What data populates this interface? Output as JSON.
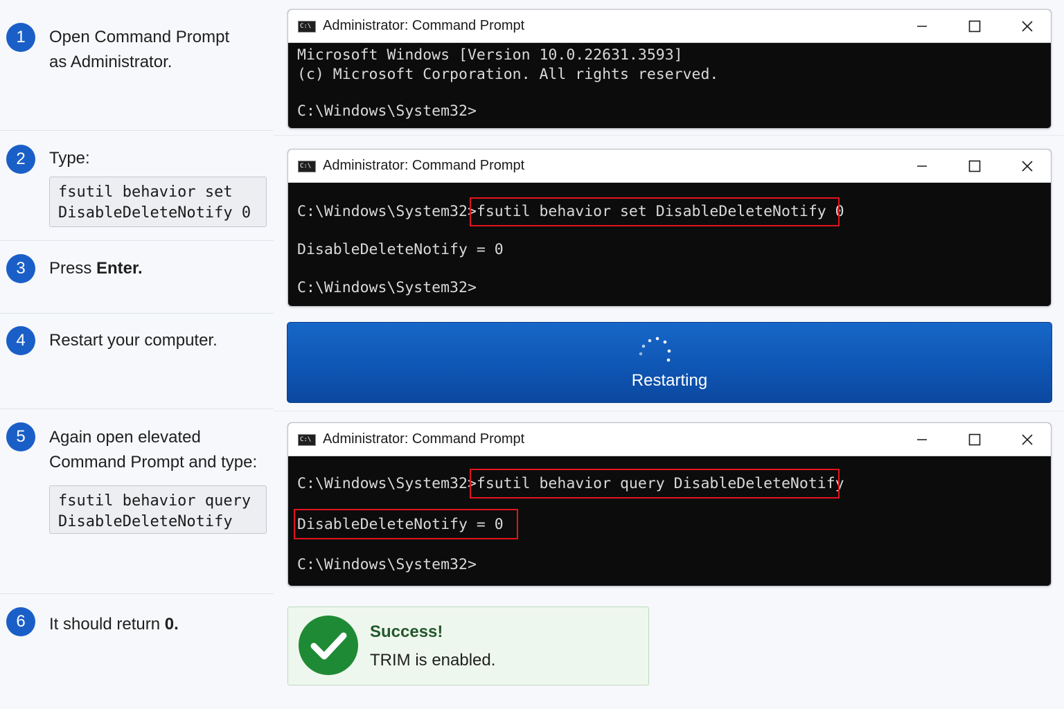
{
  "steps": [
    {
      "number": "1",
      "line1": "Open Command Prompt",
      "line2": "as Administrator."
    },
    {
      "number": "2",
      "line1": "Type:",
      "code": "fsutil behavior set\nDisableDeleteNotify 0"
    },
    {
      "number": "3",
      "prefix": "Press ",
      "bold": "Enter."
    },
    {
      "number": "4",
      "line1": "Restart your computer."
    },
    {
      "number": "5",
      "line1": "Again open elevated",
      "line2": "Command Prompt and type:",
      "code": "fsutil behavior query\nDisableDeleteNotify"
    },
    {
      "number": "6",
      "prefix": "It should return ",
      "bold": "0."
    }
  ],
  "icon_label": "C:\\",
  "window_title": "Administrator: Command Prompt",
  "windows": [
    {
      "lines": [
        "Microsoft Windows [Version 10.0.22631.3593]",
        "(c) Microsoft Corporation. All rights reserved.",
        "C:\\Windows\\System32>"
      ]
    },
    {
      "lines": [
        "C:\\Windows\\System32>fsutil behavior set DisableDeleteNotify 0",
        "DisableDeleteNotify = 0",
        "C:\\Windows\\System32>"
      ]
    },
    {
      "lines": [
        "C:\\Windows\\System32>fsutil behavior query DisableDeleteNotify",
        "DisableDeleteNotify = 0",
        "C:\\Windows\\System32>"
      ]
    }
  ],
  "restart": {
    "label": "Restarting"
  },
  "success": {
    "title": "Success!",
    "message": "TRIM is enabled."
  },
  "colors": {
    "accent": "#1a5fc7",
    "terminal_bg": "#0c0c0c",
    "highlight": "#e3141c",
    "restart_bg": "#1262c2",
    "success_green": "#1f8a35"
  },
  "icons": [
    "cmd-app-icon",
    "minimize-icon",
    "maximize-icon",
    "close-icon",
    "spinner-icon",
    "checkmark-icon"
  ]
}
